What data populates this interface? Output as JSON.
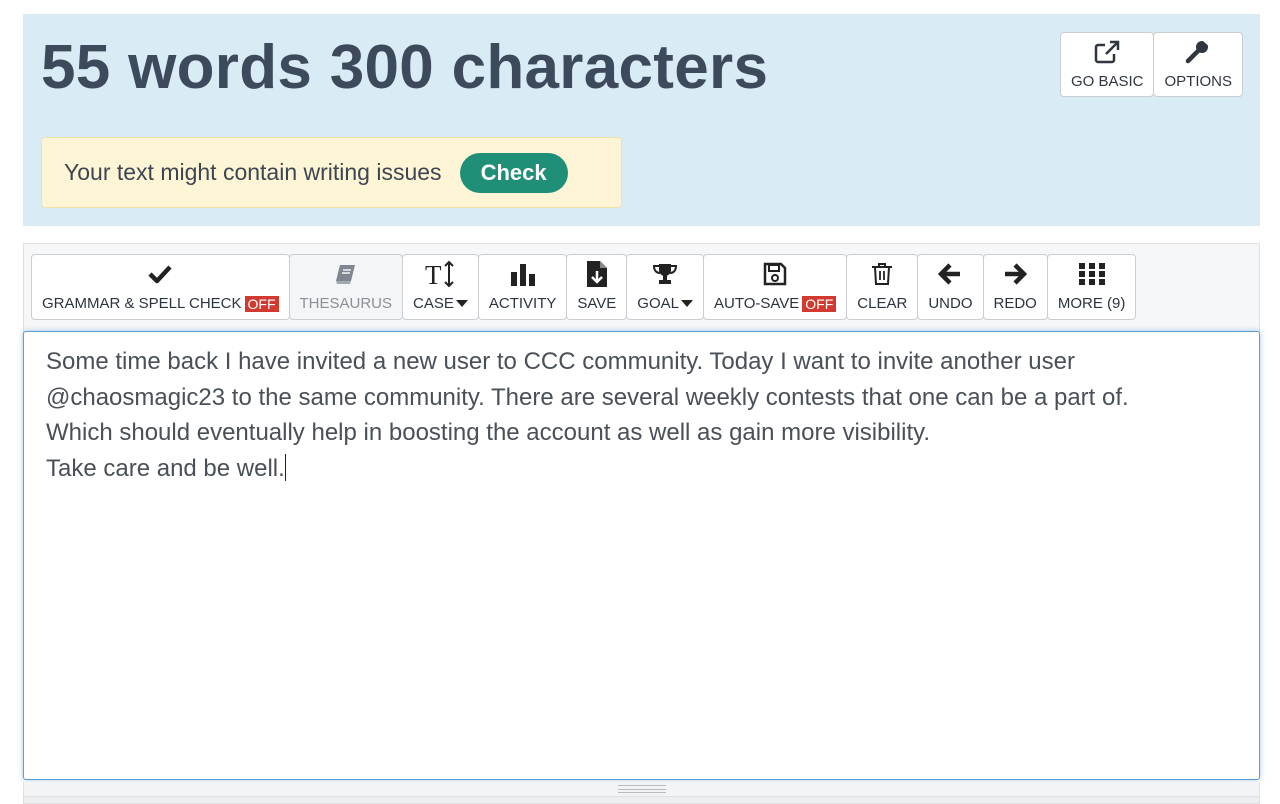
{
  "header": {
    "count_text": "55 words 300 characters",
    "go_basic_label": "GO BASIC",
    "options_label": "OPTIONS"
  },
  "issues_banner": {
    "message": "Your text might contain writing issues",
    "check_label": "Check"
  },
  "toolbar": {
    "grammar_label": "GRAMMAR & SPELL CHECK",
    "grammar_state": "OFF",
    "thesaurus_label": "THESAURUS",
    "case_label": "CASE",
    "activity_label": "ACTIVITY",
    "save_label": "SAVE",
    "goal_label": "GOAL",
    "autosave_label": "AUTO-SAVE",
    "autosave_state": "OFF",
    "clear_label": "CLEAR",
    "undo_label": "UNDO",
    "redo_label": "REDO",
    "more_label": "MORE (9)"
  },
  "editor": {
    "lines": [
      "Some time back I have invited a new user to CCC community. Today I want to invite another user",
      "@chaosmagic23 to the same community. There are several weekly contests that one can be a part of.",
      "Which should eventually help in boosting the account as well as gain more visibility.",
      "Take care and be well."
    ]
  },
  "colors": {
    "header_bg": "#d9ebf5",
    "banner_bg": "#fdf5d6",
    "check_button": "#1f8f78",
    "off_badge": "#d33a2f",
    "editor_focus_border": "#5b9fd6"
  },
  "icons": {
    "go_basic": "external-link-icon",
    "options": "wrench-icon",
    "grammar": "checkmark-icon",
    "thesaurus": "book-icon",
    "case": "text-height-icon",
    "activity": "bar-chart-icon",
    "save": "file-download-icon",
    "goal": "trophy-icon",
    "autosave": "floppy-disk-icon",
    "clear": "trash-icon",
    "undo": "arrow-left-icon",
    "redo": "arrow-right-icon",
    "more": "grid-icon"
  }
}
